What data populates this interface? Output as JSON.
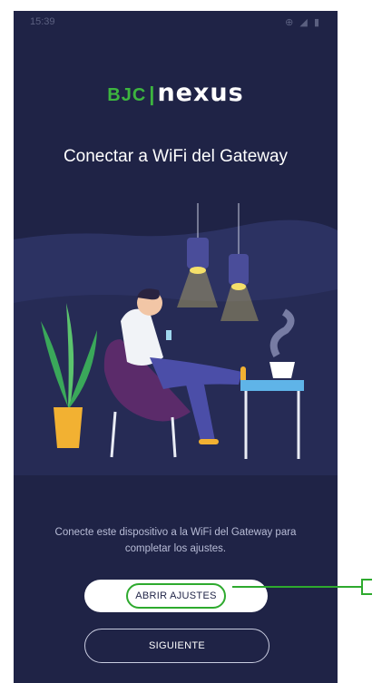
{
  "status_bar": {
    "time": "15:39",
    "icons": "⊕ ◢ ▮"
  },
  "logo": {
    "bjc": "BJC",
    "separator": "|",
    "nexus": "nexus"
  },
  "title": "Conectar a WiFi del Gateway",
  "description": "Conecte este dispositivo a la WiFi del Gateway para completar los ajustes.",
  "buttons": {
    "open_settings": "ABRIR AJUSTES",
    "next": "SIGUIENTE"
  },
  "colors": {
    "background": "#1f2346",
    "accent": "#3db53f",
    "highlight": "#2eaa2e"
  }
}
